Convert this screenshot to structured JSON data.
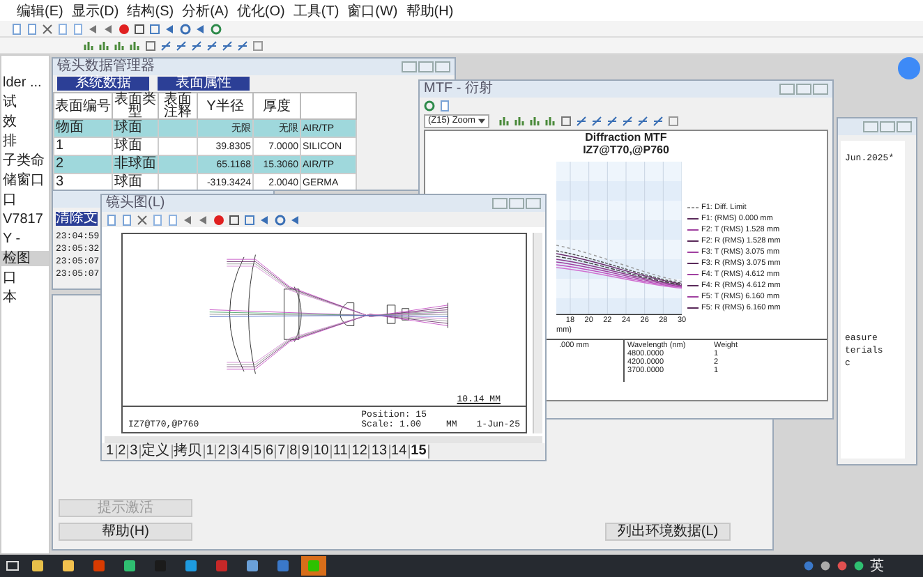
{
  "menu": [
    "编辑(E)",
    "显示(D)",
    "结构(S)",
    "分析(A)",
    "优化(O)",
    "工具(T)",
    "窗口(W)",
    "帮助(H)"
  ],
  "left_panel": {
    "items": [
      {
        "label": "lder ...",
        "selected": false
      },
      {
        "label": "试",
        "selected": false
      },
      {
        "label": "效",
        "selected": false
      },
      {
        "label": "排",
        "selected": false
      },
      {
        "label": "子类命",
        "selected": false
      },
      {
        "label": "储窗口",
        "selected": false
      },
      {
        "label": "口",
        "selected": false
      },
      {
        "label": "V7817",
        "selected": false
      },
      {
        "label": "Y -",
        "selected": false
      },
      {
        "label": "检图",
        "selected": true
      },
      {
        "label": "口",
        "selected": false
      },
      {
        "label": "本",
        "selected": false
      }
    ]
  },
  "lens_data": {
    "title": "镜头数据管理器",
    "buttons": [
      "系统数据",
      "表面属性"
    ],
    "columns": [
      "表面编号",
      "表面类型",
      "表面注释",
      "Y半径",
      "厚度"
    ],
    "rows": [
      {
        "cells": [
          "物面",
          "球面",
          "",
          "无限",
          "无限",
          "AIR/TP"
        ],
        "selected": true
      },
      {
        "cells": [
          "1",
          "球面",
          "",
          "39.8305",
          "7.0000",
          "SILICON"
        ],
        "selected": false
      },
      {
        "cells": [
          "2",
          "非球面",
          "",
          "65.1168",
          "15.3060",
          "AIR/TP"
        ],
        "selected": true
      },
      {
        "cells": [
          "3",
          "球面",
          "",
          "-319.3424",
          "2.0040",
          "GERMA"
        ],
        "selected": false
      }
    ]
  },
  "log": {
    "button": "清除文",
    "lines": [
      "23:04:59",
      "23:05:32",
      "23:05:07",
      "23:05:07"
    ]
  },
  "mtf": {
    "title": "MTF - 衍射",
    "zoom": "(Z15) Zoom",
    "chart_title": "Diffraction MTF",
    "chart_subtitle": "IZ7@T70,@P760",
    "xticks": [
      "18",
      "20",
      "22",
      "24",
      "26",
      "28",
      "30"
    ],
    "xlabel": "mm)",
    "legend": [
      "F1: Diff. Limit",
      "F1: (RMS) 0.000 mm",
      "F2: T (RMS) 1.528 mm",
      "F2: R (RMS) 1.528 mm",
      "F3: T (RMS) 3.075 mm",
      "F3: R (RMS) 3.075 mm",
      "F4: T (RMS) 4.612 mm",
      "F4: R (RMS) 4.612 mm",
      "F5: T (RMS) 6.160 mm",
      "F5: R (RMS) 6.160 mm"
    ],
    "field": ".000 mm",
    "wavelength_header": "Wavelength (nm)",
    "weight_header": "Weight",
    "wavelengths": [
      {
        "wavelength": "4800.0000",
        "weight": "1"
      },
      {
        "wavelength": "4200.0000",
        "weight": "2"
      },
      {
        "wavelength": "3700.0000",
        "weight": "1"
      }
    ]
  },
  "layout": {
    "title": "镜头图(L)",
    "scale_bar": "10.14   MM",
    "label": "IZ7@T70,@P760",
    "position": "Position:  15",
    "scale": "Scale:  1.00",
    "units": "MM",
    "date": "1-Jun-25",
    "tabs": [
      {
        "label": "1",
        "selected": false
      },
      {
        "label": "2",
        "selected": false
      },
      {
        "label": "3",
        "selected": false
      },
      {
        "label": "定义",
        "selected": false
      },
      {
        "label": "拷贝",
        "selected": false
      },
      {
        "label": "1",
        "selected": false
      },
      {
        "label": "2",
        "selected": false
      },
      {
        "label": "3",
        "selected": false
      },
      {
        "label": "4",
        "selected": false
      },
      {
        "label": "5",
        "selected": false
      },
      {
        "label": "6",
        "selected": false
      },
      {
        "label": "7",
        "selected": false
      },
      {
        "label": "8",
        "selected": false
      },
      {
        "label": "9",
        "selected": false
      },
      {
        "label": "10",
        "selected": false
      },
      {
        "label": "11",
        "selected": false
      },
      {
        "label": "12",
        "selected": false
      },
      {
        "label": "13",
        "selected": false
      },
      {
        "label": "14",
        "selected": false
      },
      {
        "label": "15",
        "selected": true
      }
    ]
  },
  "notes": {
    "lines": [
      "Jun.2025*",
      "easure",
      "terials",
      "c"
    ]
  },
  "dialog": {
    "buttons": [
      {
        "label": "提示激活",
        "disabled": true
      },
      {
        "label": "帮助(H)",
        "disabled": false
      }
    ],
    "action": "列出环境数据(L)"
  },
  "taskbar": {
    "apps": [
      {
        "kind": "store",
        "selected": false
      },
      {
        "kind": "folder",
        "selected": false
      },
      {
        "kind": "office",
        "selected": false
      },
      {
        "kind": "green",
        "selected": false
      },
      {
        "kind": "dark",
        "selected": false
      },
      {
        "kind": "edge",
        "selected": false
      },
      {
        "kind": "red",
        "selected": false
      },
      {
        "kind": "camera",
        "selected": false
      },
      {
        "kind": "monitor",
        "selected": false
      },
      {
        "kind": "chat",
        "selected": true
      }
    ],
    "ime": "英"
  }
}
